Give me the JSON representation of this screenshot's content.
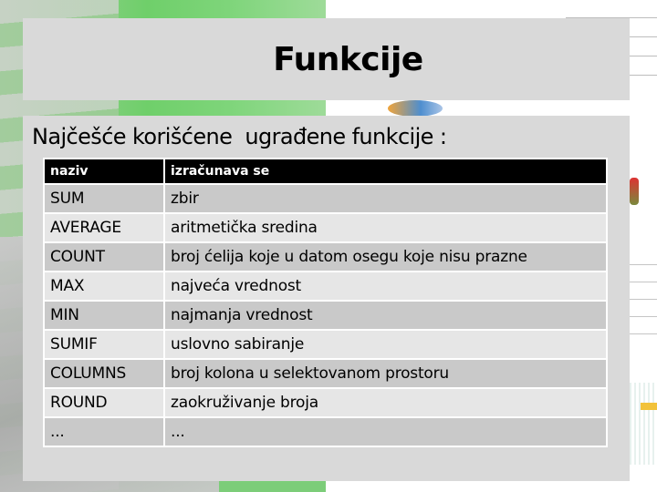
{
  "slide": {
    "title": "Funkcije",
    "subtitle": "Najčešće korišćene  ugrađene funkcije :"
  },
  "table": {
    "headers": [
      "naziv",
      "izračunava se"
    ],
    "rows": [
      {
        "name": "SUM",
        "description": "zbir"
      },
      {
        "name": "AVERAGE",
        "description": "aritmetička sredina"
      },
      {
        "name": "COUNT",
        "description": "broj ćelija koje u datom osegu koje nisu prazne"
      },
      {
        "name": "MAX",
        "description": "najveća vrednost"
      },
      {
        "name": "MIN",
        "description": "najmanja vrednost"
      },
      {
        "name": "SUMIF",
        "description": "uslovno sabiranje"
      },
      {
        "name": "COLUMNS",
        "description": "broj kolona u selektovanom prostoru"
      },
      {
        "name": "ROUND",
        "description": "zaokruživanje broja"
      },
      {
        "name": "...",
        "description": "..."
      }
    ]
  },
  "colors": {
    "panel_bg": "#d9d9d9",
    "header_bg": "#000000",
    "row_dark": "#c9c9c9",
    "row_light": "#e6e6e6"
  }
}
